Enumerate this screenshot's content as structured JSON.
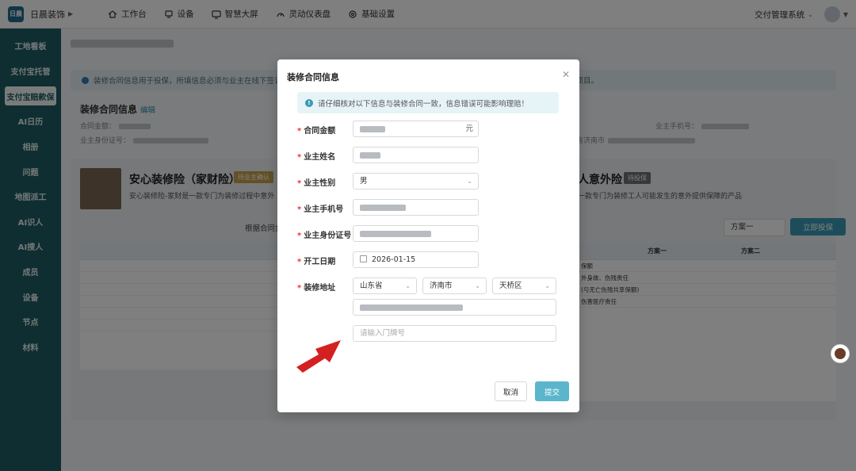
{
  "topbar": {
    "brand": "日晨装饰",
    "nav": [
      {
        "label": "工作台",
        "icon": "home-icon"
      },
      {
        "label": "设备",
        "icon": "device-icon"
      },
      {
        "label": "智慧大屏",
        "icon": "monitor-icon"
      },
      {
        "label": "灵动仪表盘",
        "icon": "dashboard-icon"
      },
      {
        "label": "基础设置",
        "icon": "gear-icon"
      }
    ],
    "system": "交付管理系统"
  },
  "sidebar": {
    "items": [
      "工地看板",
      "支付宝托管",
      "支付宝赔款保",
      "AI日历",
      "相册",
      "问题",
      "地图派工",
      "AI识人",
      "AI搜人",
      "成员",
      "设备",
      "节点",
      "材料"
    ],
    "active_index": 2
  },
  "background": {
    "notice": "装修合同信息用于投保，所填信息必须与业主在线下签订",
    "notice_tail": "项目。",
    "section_title": "装修合同信息",
    "section_edit": "编辑",
    "kv": [
      "合同金额：",
      "业主手机号：",
      "业主身份证号：",
      "省济南市"
    ],
    "ins1": {
      "title": "安心装修险（家财险）",
      "tag": "待业主确认",
      "desc": "安心装修险-家财是一款专门为装修过程中意外"
    },
    "ins2": {
      "title": "人意外险",
      "tag": "待投保",
      "desc": "一款专门为装修工人可能发生的意外提供保障的产品"
    },
    "amount_label": "根据合同金额",
    "plan_select": "方案一",
    "buy_button": "立即投保",
    "right_table_rows": [
      "保额",
      "外身故、伤残责任",
      "(与无亡伤残共享保额)",
      "伤害医疗责任"
    ],
    "right_table_cols": [
      "方案一",
      "方案二"
    ]
  },
  "modal": {
    "title": "装修合同信息",
    "alert": "请仔细核对以下信息与装修合同一致，信息错误可能影响理赔！",
    "fields": {
      "amount": {
        "label": "合同金额",
        "suffix": "元"
      },
      "name": {
        "label": "业主姓名"
      },
      "gender": {
        "label": "业主性别",
        "value": "男"
      },
      "phone": {
        "label": "业主手机号"
      },
      "idcard": {
        "label": "业主身份证号"
      },
      "start_date": {
        "label": "开工日期",
        "value": "2026-01-15"
      },
      "address": {
        "label": "装修地址",
        "province": "山东省",
        "city": "济南市",
        "district": "天桥区",
        "door_placeholder": "请输入门牌号"
      }
    },
    "cancel": "取消",
    "submit": "提交"
  },
  "colors": {
    "sidebar": "#1e5d62",
    "primary": "#5bb5cc",
    "required": "#ee3333",
    "arrow": "#d42020"
  }
}
